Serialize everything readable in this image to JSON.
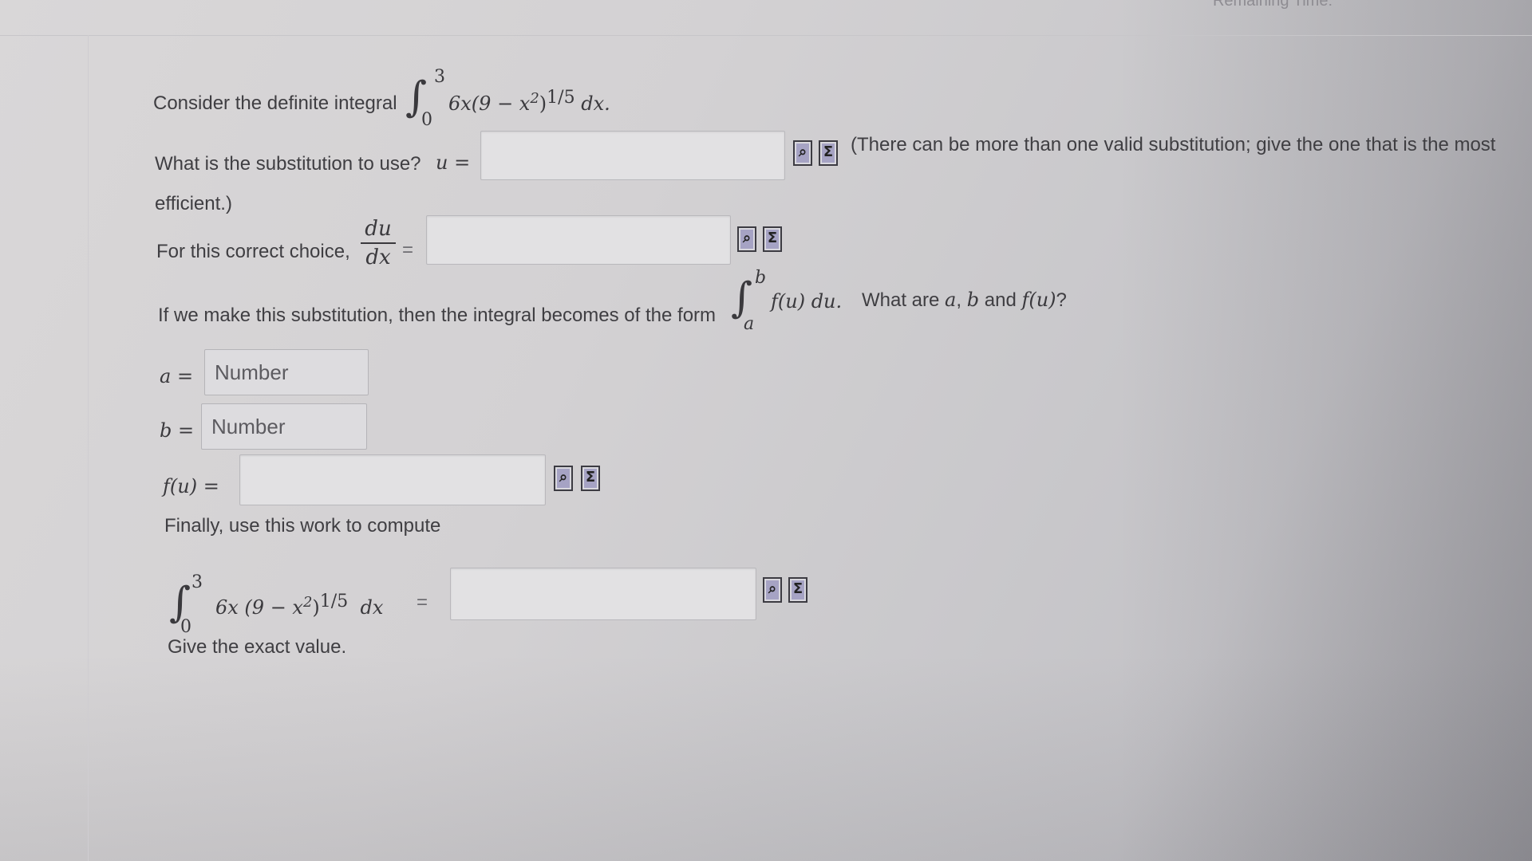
{
  "header": {
    "timer_label": "Remaining Time:"
  },
  "question": {
    "intro": "Consider the definite integral",
    "integral": {
      "lower": "0",
      "upper": "3",
      "integrand": "6x(9 − x",
      "exp2": "2",
      "close": ")",
      "exp": "1/5",
      "dx": "dx."
    },
    "substitution_prompt": "What is the substitution to use?",
    "u_label": "u =",
    "substitution_hint": "(There can be more than one valid substitution; give the one that is the most",
    "substitution_hint_cont": "efficient.)",
    "derivative_prompt": "For this correct choice,",
    "du": "du",
    "dx": "dx",
    "equals": "=",
    "form_prompt": "If we make this substitution, then the integral becomes of the form",
    "form_lower": "a",
    "form_upper": "b",
    "form_expr": "f(u) du.",
    "form_question_pre": "What are",
    "form_a": "a",
    "comma": ",",
    "form_b": "b",
    "and": "and",
    "form_fu": "f(u)",
    "qmark": "?",
    "a_label": "a =",
    "b_label": "b =",
    "a_placeholder": "Number",
    "b_placeholder": "Number",
    "fu_label": "f(u) =",
    "finally": "Finally, use this work to compute",
    "final_integral": {
      "lower": "0",
      "upper": "3",
      "integrand": "6x (9 − x",
      "exp2": "2",
      "close": ")",
      "exp": "1/5",
      "dx": "dx",
      "equals": "="
    },
    "exact_note": "Give the exact value."
  },
  "icons": {
    "preview": "preview-icon",
    "sigma": "sigma-icon",
    "preview_glyph": "⌕",
    "sigma_glyph": "Σ"
  }
}
